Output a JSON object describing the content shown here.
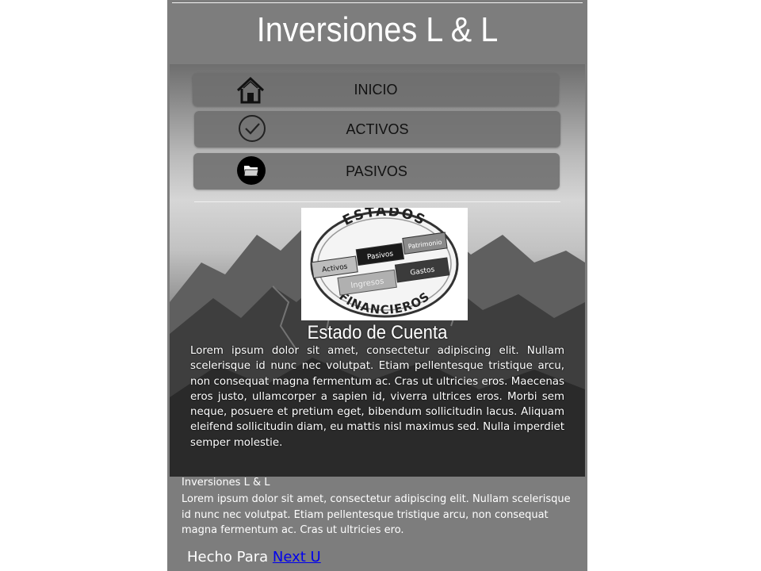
{
  "header": {
    "title": "Inversiones L & L"
  },
  "nav": {
    "items": [
      {
        "label": "INICIO",
        "icon": "home-icon"
      },
      {
        "label": "ACTIVOS",
        "icon": "check-circle-icon"
      },
      {
        "label": "PASIVOS",
        "icon": "folder-icon"
      }
    ]
  },
  "logo": {
    "top_text": "ESTADOS",
    "bottom_text": "FINANCIEROS",
    "tiles": [
      "Activos",
      "Pasivos",
      "Patrimonio",
      "Ingresos",
      "Gastos"
    ]
  },
  "section": {
    "title": "Estado de Cuenta",
    "body": "Lorem ipsum dolor sit amet, consectetur adipiscing elit. Nullam scelerisque id nunc nec volutpat. Etiam pellentesque tristique arcu, non consequat magna fermentum ac. Cras ut ultricies eros. Maecenas eros justo, ullamcorper a sapien id, viverra ultrices eros. Morbi sem neque, posuere et pretium eget, bibendum sollicitudin lacus. Aliquam eleifend sollicitudin diam, eu mattis nisl maximus sed. Nulla imperdiet semper molestie."
  },
  "footer": {
    "name": "Inversiones L & L",
    "text": "Lorem ipsum dolor sit amet, consectetur adipiscing elit. Nullam scelerisque id nunc nec volutpat. Etiam pellentesque tristique arcu, non consequat magna fermentum ac. Cras ut ultricies ero.",
    "made_for_prefix": "Hecho Para",
    "made_for_link": "Next U"
  },
  "colors": {
    "page_bg": "#7d7d7d",
    "button_bg": "#6e6e6e",
    "link": "#0000ee"
  }
}
